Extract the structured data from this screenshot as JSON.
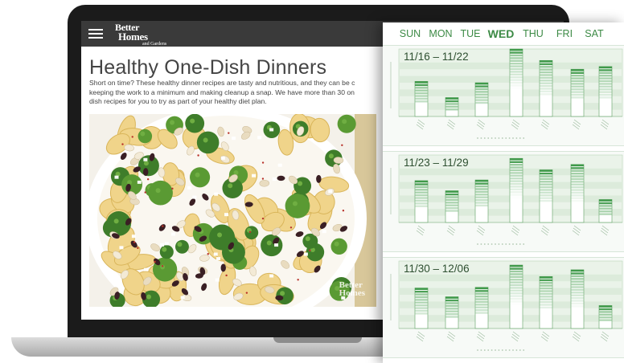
{
  "site": {
    "brand_line1": "Better",
    "brand_line2": "Homes",
    "brand_line3": "and Gardens",
    "header_color": "#3a3a3a"
  },
  "article": {
    "title": "Healthy One-Dish Dinners",
    "intro_line1": "Short on time? These healthy dinner recipes are tasty and nutritious, and they can be c",
    "intro_line2": "keeping the work to a minimum and making cleanup a snap. We have more than 30 on",
    "intro_line3": "dish recipes for you to try as part of your healthy diet plan.",
    "watermark_line1": "Better",
    "watermark_line2": "Homes"
  },
  "calendar": {
    "accent_color": "#3c8a45",
    "days": [
      "SUN",
      "MON",
      "TUE",
      "WED",
      "THU",
      "FRI",
      "SAT"
    ],
    "active_day": "WED",
    "weeks": [
      {
        "range": "11/16 – 11/22",
        "values": [
          52,
          28,
          50,
          100,
          83,
          70,
          74
        ]
      },
      {
        "range": "11/23 – 11/29",
        "values": [
          62,
          47,
          63,
          95,
          78,
          86,
          34
        ]
      },
      {
        "range": "11/30 – 12/06",
        "values": [
          60,
          47,
          61,
          94,
          77,
          87,
          34
        ]
      }
    ]
  }
}
